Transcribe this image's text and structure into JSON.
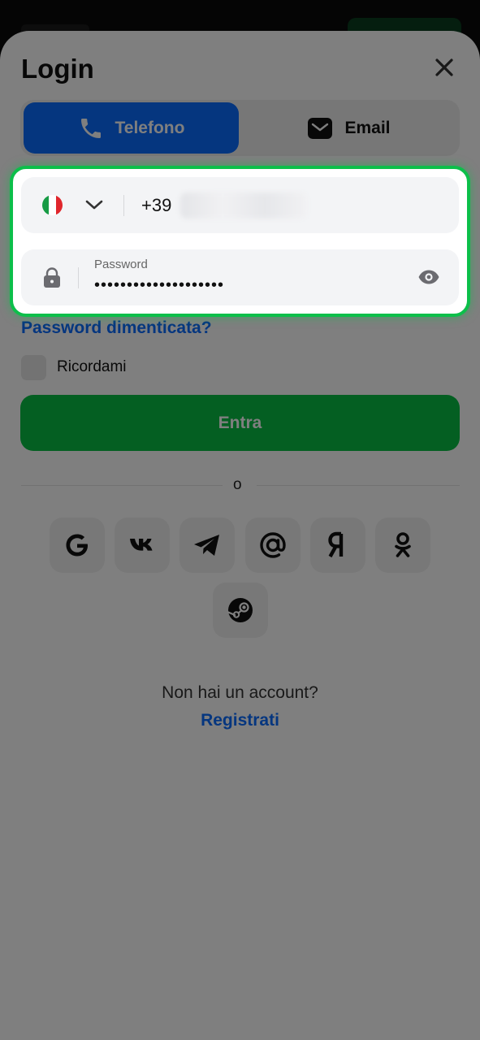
{
  "title": "Login",
  "tabs": [
    {
      "label": "Telefono",
      "icon": "phone-icon",
      "active": true
    },
    {
      "label": "Email",
      "icon": "mail-icon",
      "active": false
    }
  ],
  "phone": {
    "country_flag": "flag-italy-icon",
    "prefix": "+39"
  },
  "password": {
    "label": "Password",
    "value": "••••••••••••••••••••"
  },
  "forgot": "Password dimenticata?",
  "remember": "Ricordami",
  "submit": "Entra",
  "or": "o",
  "social": [
    "google-icon",
    "vk-icon",
    "telegram-icon",
    "mail-at-icon",
    "yandex-icon",
    "odnoklassniki-icon",
    "steam-icon"
  ],
  "no_account": "Non hai un account?",
  "register": "Registrati",
  "colors": {
    "accent": "#0a6cff",
    "green": "#08bf45",
    "highlight": "#0cbf4a"
  }
}
